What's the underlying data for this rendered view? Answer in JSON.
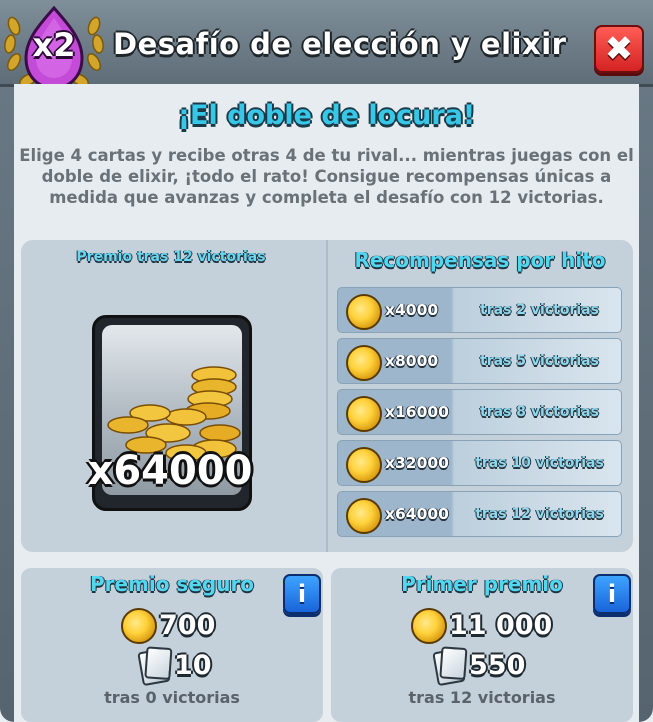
{
  "header": {
    "title": "Desafío de elección y elixir",
    "badge_label": "x2",
    "close_icon": "close-icon"
  },
  "intro": {
    "subtitle": "¡El doble de locura!",
    "description": "Elige 4 cartas y recibe otras 4 de tu rival... mientras juegas con el doble de elixir, ¡todo el rato! Consigue recompensas únicas a medida que avanzas y completa el desafío con 12 victorias."
  },
  "grand_prize": {
    "label": "Premio tras 12 victorias",
    "amount": "x64000"
  },
  "milestones": {
    "title": "Recompensas por hito",
    "items": [
      {
        "amount": "x4000",
        "when": "tras 2 victorias"
      },
      {
        "amount": "x8000",
        "when": "tras 5 victorias"
      },
      {
        "amount": "x16000",
        "when": "tras 8 victorias"
      },
      {
        "amount": "x32000",
        "when": "tras 10 victorias"
      },
      {
        "amount": "x64000",
        "when": "tras 12 victorias"
      }
    ]
  },
  "safe_prize": {
    "title": "Premio seguro",
    "gold": "700",
    "cards": "10",
    "footer": "tras 0  victorias"
  },
  "first_prize": {
    "title": "Primer premio",
    "gold": "11 000",
    "cards": "550",
    "footer": "tras 12  victorias"
  },
  "colors": {
    "accent_cyan": "#39c7e8",
    "close_red": "#d42323",
    "info_blue": "#1a64d9",
    "gold": "#ffd13b"
  }
}
